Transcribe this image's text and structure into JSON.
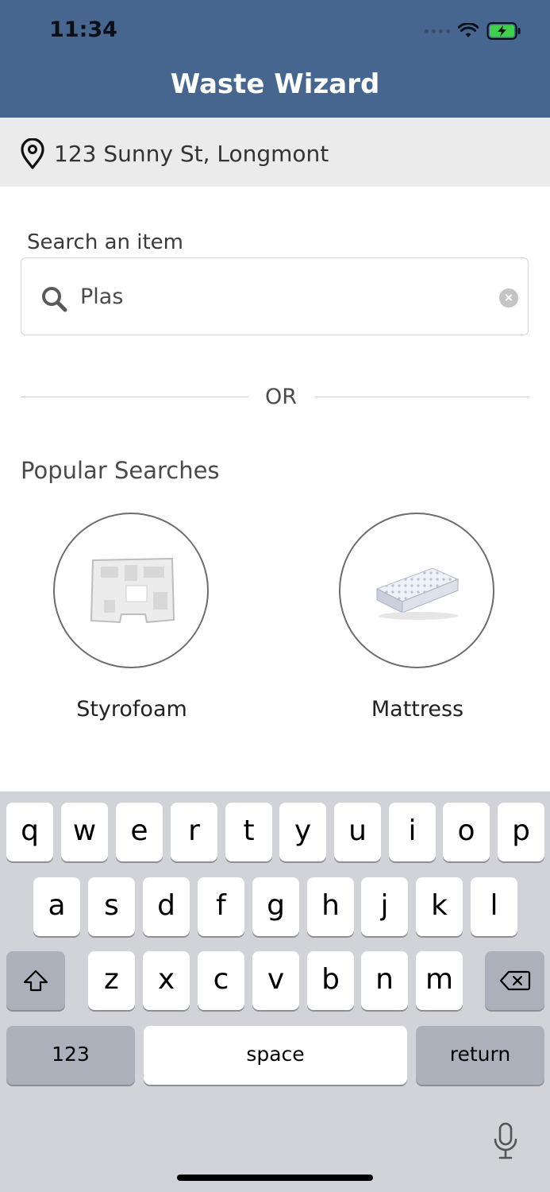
{
  "status_bar": {
    "time": "11:34"
  },
  "header": {
    "title": "Waste Wizard"
  },
  "location": {
    "address": "123 Sunny St, Longmont",
    "icon": "map-pin-icon"
  },
  "search": {
    "label": "Search an item",
    "value": "Plas",
    "icon": "search-icon"
  },
  "divider": {
    "text": "OR"
  },
  "popular": {
    "title": "Popular Searches",
    "items": [
      {
        "label": "Styrofoam",
        "icon": "styrofoam-image"
      },
      {
        "label": "Mattress",
        "icon": "mattress-image"
      }
    ]
  },
  "keyboard": {
    "row1": [
      "q",
      "w",
      "e",
      "r",
      "t",
      "y",
      "u",
      "i",
      "o",
      "p"
    ],
    "row2": [
      "a",
      "s",
      "d",
      "f",
      "g",
      "h",
      "j",
      "k",
      "l"
    ],
    "row3": [
      "z",
      "x",
      "c",
      "v",
      "b",
      "n",
      "m"
    ],
    "numbers_label": "123",
    "space_label": "space",
    "return_label": "return"
  }
}
